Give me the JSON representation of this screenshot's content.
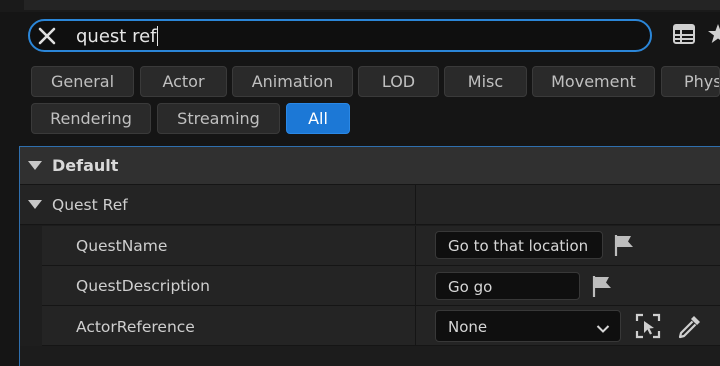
{
  "search": {
    "query": "quest ref",
    "clear_icon": "close-icon"
  },
  "toolbar": {
    "table_view_icon": "table-icon",
    "star_icon": "star-icon"
  },
  "filters": [
    {
      "label": "General",
      "active": false
    },
    {
      "label": "Actor",
      "active": false
    },
    {
      "label": "Animation",
      "active": false
    },
    {
      "label": "LOD",
      "active": false
    },
    {
      "label": "Misc",
      "active": false
    },
    {
      "label": "Movement",
      "active": false
    },
    {
      "label": "Physics",
      "active": false
    },
    {
      "label": "Rendering",
      "active": false
    },
    {
      "label": "Streaming",
      "active": false
    },
    {
      "label": "All",
      "active": true
    }
  ],
  "details": {
    "category": "Default",
    "group": "Quest Ref",
    "properties": [
      {
        "name": "QuestName",
        "value": "Go to that location",
        "icon": "flag-icon"
      },
      {
        "name": "QuestDescription",
        "value": "Go go",
        "icon": "flag-icon"
      },
      {
        "name": "ActorReference",
        "value": "None",
        "icons": [
          "dropdown-chevron-icon",
          "pick-actor-icon",
          "eyedropper-icon"
        ]
      }
    ]
  },
  "colors": {
    "accent": "#1c78d6",
    "focus_border": "#2b86d8",
    "panel_bg": "#242424"
  }
}
